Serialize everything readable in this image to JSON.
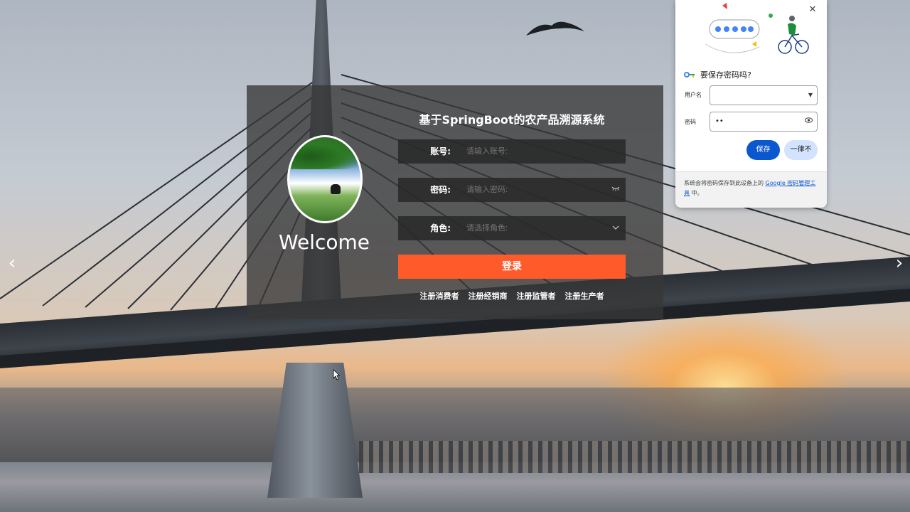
{
  "carousel": {
    "prev_icon": "chevron-left-icon",
    "next_icon": "chevron-right-icon",
    "prev_glyph": "‹",
    "next_glyph": "›"
  },
  "login": {
    "welcome": "Welcome",
    "title": "基于SpringBoot的农产品溯源系统",
    "fields": {
      "account": {
        "label": "账号:",
        "placeholder": "请输入账号:"
      },
      "password": {
        "label": "密码:",
        "placeholder": "请输入密码:",
        "icon": "eye-closed-icon"
      },
      "role": {
        "label": "角色:",
        "placeholder": "请选择角色:",
        "icon": "chevron-down-icon"
      }
    },
    "login_button": "登录",
    "register_links": [
      "注册消费者",
      "注册经销商",
      "注册监管者",
      "注册生产者"
    ],
    "accent_color": "#ff5a2a"
  },
  "password_popup": {
    "title": "要保存密码吗?",
    "username_label": "用户名",
    "username_value": "",
    "password_label": "密码",
    "password_value": "••",
    "save_button": "保存",
    "never_button": "一律不",
    "footer_text_prefix": "系统会将密码保存到此设备上的",
    "footer_link": "Google 密码管理工具",
    "footer_text_suffix": "中。",
    "primary_color": "#0b57d0"
  }
}
